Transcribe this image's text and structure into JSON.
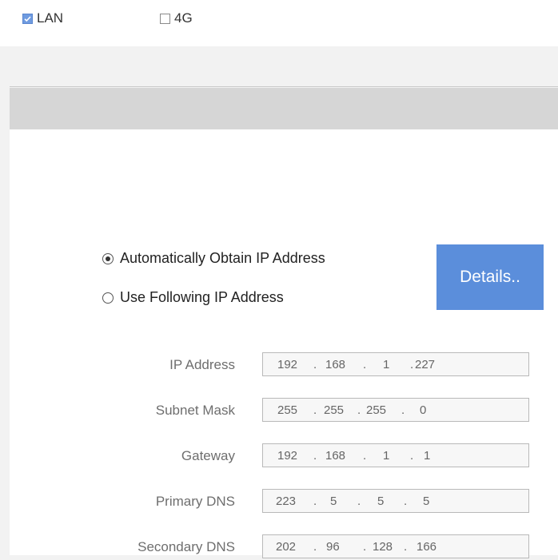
{
  "connection_types": {
    "lan": {
      "label": "LAN",
      "checked": true
    },
    "g4": {
      "label": "4G",
      "checked": false
    }
  },
  "ip_mode": {
    "auto_label": "Automatically Obtain IP Address",
    "manual_label": "Use Following IP Address",
    "selected": "auto"
  },
  "details_button": {
    "label": "Details.."
  },
  "fields": [
    {
      "label": "IP Address",
      "octets": [
        "192",
        "168",
        "1",
        "227"
      ]
    },
    {
      "label": "Subnet Mask",
      "octets": [
        "255",
        "255",
        "255",
        "0"
      ]
    },
    {
      "label": "Gateway",
      "octets": [
        "192",
        "168",
        "1",
        "1"
      ]
    },
    {
      "label": "Primary DNS",
      "octets": [
        "223",
        "5",
        "5",
        "5"
      ]
    },
    {
      "label": "Secondary DNS",
      "octets": [
        "202",
        "96",
        "128",
        "166"
      ]
    }
  ],
  "colors": {
    "accent": "#5b8edb",
    "checkbox_checked": "#6f9be0",
    "band": "#d6d6d6",
    "field_border": "#b9b9b9",
    "label_text": "#6e6e6e"
  }
}
